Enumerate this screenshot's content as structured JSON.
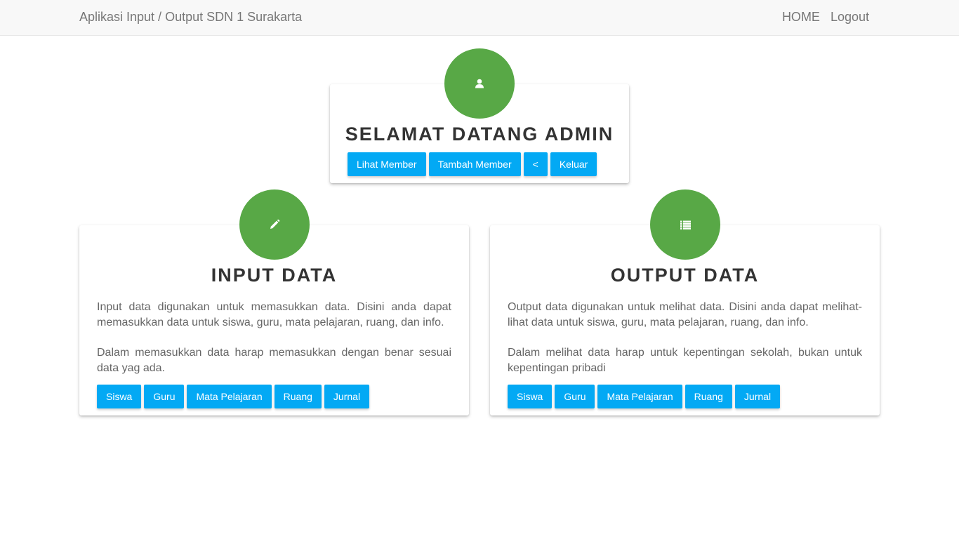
{
  "navbar": {
    "brand": "Aplikasi Input / Output SDN 1 Surakarta",
    "links": [
      "HOME",
      "Logout"
    ]
  },
  "welcome": {
    "title_prefix": "SELAMAT DATANG ",
    "title_user": "ADMIN",
    "icon": "user-icon",
    "buttons": [
      "Lihat Member",
      "Tambah Member",
      "<",
      "Keluar"
    ]
  },
  "input_panel": {
    "title": "INPUT DATA",
    "icon": "pencil-icon",
    "paragraph1": "Input data digunakan untuk memasukkan data. Disini anda dapat memasukkan data untuk siswa, guru, mata pelajaran, ruang, dan info.",
    "paragraph2": "Dalam memasukkan data harap memasukkan dengan benar sesuai data yag ada.",
    "buttons": [
      "Siswa",
      "Guru",
      "Mata Pelajaran",
      "Ruang",
      "Jurnal"
    ]
  },
  "output_panel": {
    "title": "OUTPUT DATA",
    "icon": "list-icon",
    "paragraph1": "Output data digunakan untuk melihat data. Disini anda dapat melihat-lihat data untuk siswa, guru, mata pelajaran, ruang, dan info.",
    "paragraph2": "Dalam melihat data harap untuk kepentingan sekolah, bukan untuk kepentingan pribadi",
    "buttons": [
      "Siswa",
      "Guru",
      "Mata Pelajaran",
      "Ruang",
      "Jurnal"
    ]
  },
  "colors": {
    "accent_green": "#58a846",
    "button_blue": "#03a9f4",
    "navbar_bg": "#f8f8f8"
  }
}
